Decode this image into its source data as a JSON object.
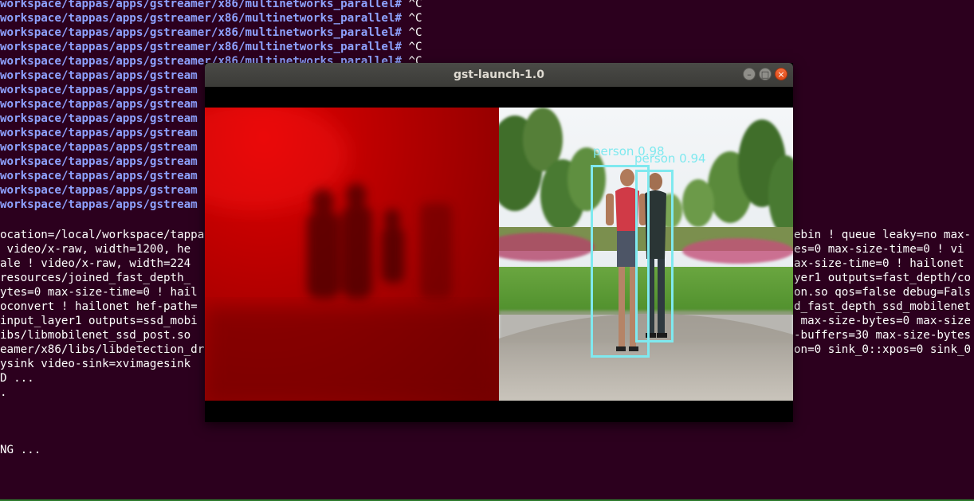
{
  "terminal": {
    "prompt_lines": [
      {
        "prompt": "workspace/tappas/apps/gstreamer/x86/multinetworks_parallel#",
        "cmd": " ^C"
      },
      {
        "prompt": "workspace/tappas/apps/gstreamer/x86/multinetworks_parallel#",
        "cmd": " ^C"
      },
      {
        "prompt": "workspace/tappas/apps/gstreamer/x86/multinetworks_parallel#",
        "cmd": " ^C"
      },
      {
        "prompt": "workspace/tappas/apps/gstreamer/x86/multinetworks_parallel#",
        "cmd": " ^C"
      },
      {
        "prompt": "workspace/tappas/apps/gstreamer/x86/multinetworks_parallel#",
        "cmd": " ^C"
      },
      {
        "prompt": "workspace/tappas/apps/gstream",
        "cmd": ""
      },
      {
        "prompt": "workspace/tappas/apps/gstream",
        "cmd": ""
      },
      {
        "prompt": "workspace/tappas/apps/gstream",
        "cmd": ""
      },
      {
        "prompt": "workspace/tappas/apps/gstream",
        "cmd": ""
      },
      {
        "prompt": "workspace/tappas/apps/gstream",
        "cmd": ""
      },
      {
        "prompt": "workspace/tappas/apps/gstream",
        "cmd": ""
      },
      {
        "prompt": "workspace/tappas/apps/gstream",
        "cmd": ""
      },
      {
        "prompt": "workspace/tappas/apps/gstream",
        "cmd": ""
      },
      {
        "prompt": "workspace/tappas/apps/gstream",
        "cmd": ""
      },
      {
        "prompt": "workspace/tappas/apps/gstream",
        "cmd": ""
      }
    ],
    "output_left": [
      "ocation=/local/workspace/tappa",
      " video/x-raw, width=1200, he",
      "ale ! video/x-raw, width=224",
      "resources/joined_fast_depth_",
      "ytes=0 max-size-time=0 ! hail",
      "oconvert ! hailonet hef-path=",
      "input_layer1 outputs=ssd_mobi",
      "ibs/libmobilenet_ssd_post.so ",
      "eamer/x86/libs/libdetection_dr",
      "ysink video-sink=xvimagesink",
      "D ...",
      ".",
      "",
      "",
      "",
      "NG ...",
      ""
    ],
    "output_right": [
      "ebin ! queue leaky=no max-",
      "es=0 max-size-time=0 ! vi",
      "ax-size-time=0 ! hailonet",
      "yer1 outputs=fast_depth/co",
      "on.so qos=false debug=Fals",
      "d_fast_depth_ssd_mobilenet",
      " max-size-bytes=0 max-size",
      "-buffers=30 max-size-bytes",
      "on=0 sink_0::xpos=0 sink_0"
    ],
    "colors": {
      "background": "#2c001e",
      "prompt": "#8ea2ff",
      "text": "#ffffff"
    }
  },
  "window": {
    "title": "gst-launch-1.0",
    "controls": {
      "minimize": "–",
      "maximize": "□",
      "close": "×"
    }
  },
  "detections": [
    {
      "label": "person 0.98"
    },
    {
      "label": "person 0.94"
    }
  ]
}
